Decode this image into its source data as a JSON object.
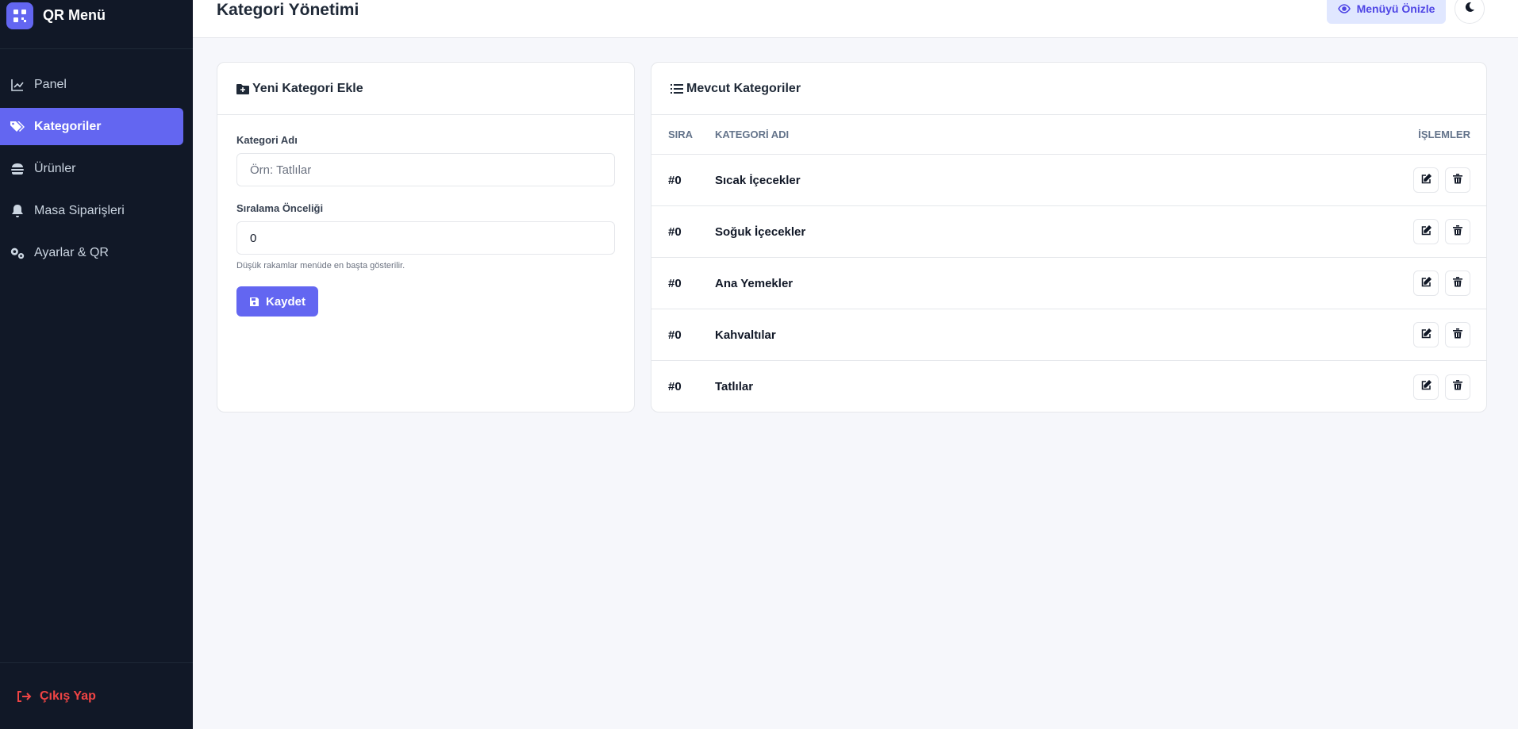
{
  "brand": {
    "title": "QR Menü",
    "logo_icon": "qrcode-icon"
  },
  "sidebar": {
    "items": [
      {
        "label": "Panel",
        "icon": "chart-line-icon",
        "active": false
      },
      {
        "label": "Kategoriler",
        "icon": "tags-icon",
        "active": true
      },
      {
        "label": "Ürünler",
        "icon": "burger-icon",
        "active": false
      },
      {
        "label": "Masa Siparişleri",
        "icon": "bell-icon",
        "active": false
      },
      {
        "label": "Ayarlar & QR",
        "icon": "gears-icon",
        "active": false
      }
    ],
    "logout_label": "Çıkış Yap"
  },
  "header": {
    "title": "Kategori Yönetimi",
    "preview_label": "Menüyü Önizle",
    "theme_icon": "moon-icon"
  },
  "add_form": {
    "title": "Yeni Kategori Ekle",
    "name_label": "Kategori Adı",
    "name_placeholder": "Örn: Tatlılar",
    "name_value": "",
    "order_label": "Sıralama Önceliği",
    "order_value": "0",
    "order_help": "Düşük rakamlar menüde en başta gösterilir.",
    "save_label": "Kaydet"
  },
  "categories": {
    "title": "Mevcut Kategoriler",
    "columns": {
      "order": "SIRA",
      "name": "KATEGORİ ADI",
      "actions": "İŞLEMLER"
    },
    "rows": [
      {
        "order": "#0",
        "name": "Sıcak İçecekler"
      },
      {
        "order": "#0",
        "name": "Soğuk İçecekler"
      },
      {
        "order": "#0",
        "name": "Ana Yemekler"
      },
      {
        "order": "#0",
        "name": "Kahvaltılar"
      },
      {
        "order": "#0",
        "name": "Tatlılar"
      }
    ]
  },
  "colors": {
    "accent": "#6366f1",
    "sidebar_bg": "#111827",
    "danger": "#ef4444"
  }
}
